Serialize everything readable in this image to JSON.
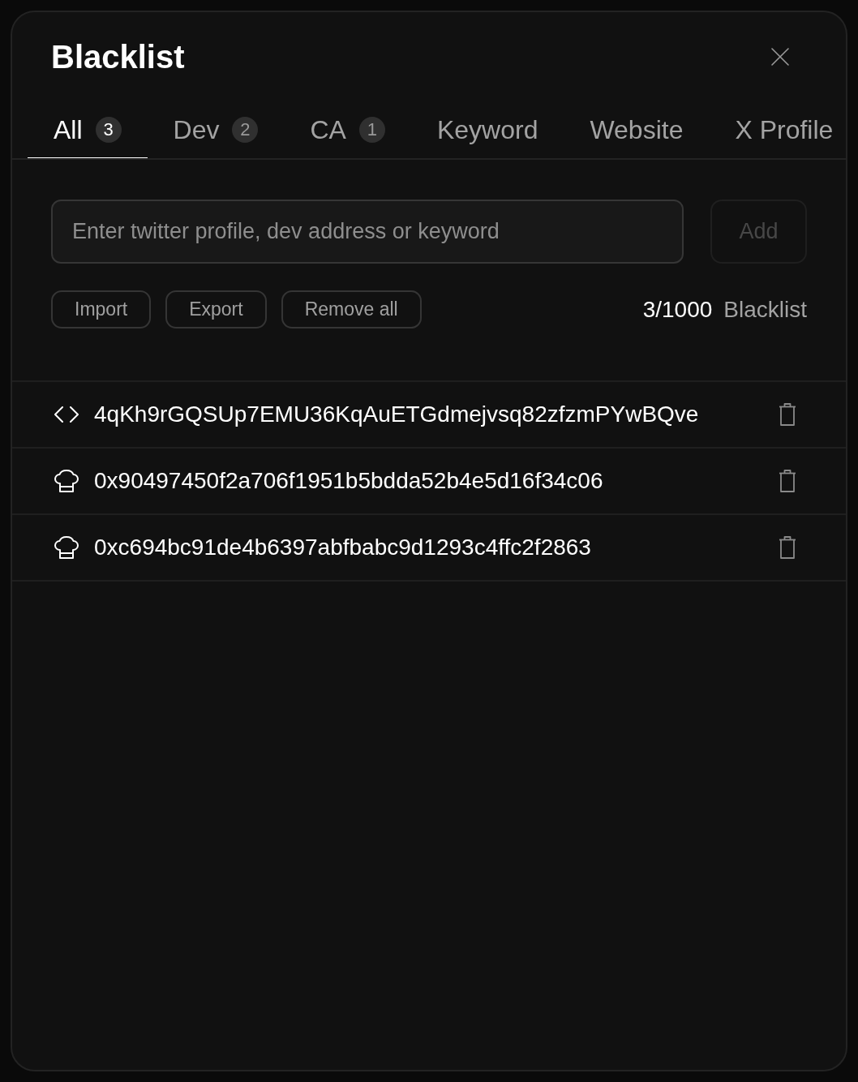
{
  "dialog": {
    "title": "Blacklist"
  },
  "tabs": [
    {
      "label": "All",
      "count": "3",
      "selected": true
    },
    {
      "label": "Dev",
      "count": "2",
      "selected": false
    },
    {
      "label": "CA",
      "count": "1",
      "selected": false
    },
    {
      "label": "Keyword",
      "selected": false
    },
    {
      "label": "Website",
      "selected": false
    },
    {
      "label": "X Profile",
      "selected": false
    }
  ],
  "search": {
    "placeholder": "Enter twitter profile, dev address or keyword"
  },
  "add_button": {
    "label": "Add",
    "disabled": true
  },
  "actions": [
    "Import",
    "Export",
    "Remove all"
  ],
  "counter": {
    "value": "3/1000",
    "label": "Blacklist"
  },
  "entries": [
    {
      "kind": "ca",
      "value": "4qKh9rGQSUp7EMU36KqAuETGdmejvsq82zfzmPYwBQve"
    },
    {
      "kind": "dev",
      "value": "0x90497450f2a706f1951b5bdda52b4e5d16f34c06"
    },
    {
      "kind": "dev",
      "value": "0xc694bc91de4b6397abfbabc9d1293c4ffc2f2863"
    }
  ]
}
